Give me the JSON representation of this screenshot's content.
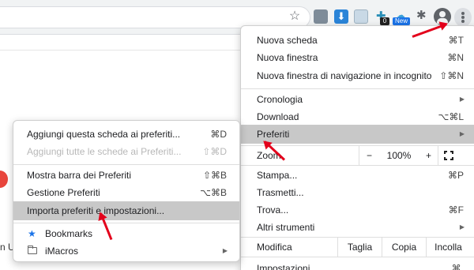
{
  "toolbar": {
    "star_icon": "star-icon",
    "extensions": [
      "ext-icon",
      "download-ext-icon",
      "image-ext-icon",
      "puzzle-ext-icon",
      "cloud-ext-icon",
      "extensions-puzzle-icon"
    ],
    "badge_count": "0",
    "badge_new": "New"
  },
  "page": {
    "partial_text": "n U"
  },
  "main_menu": {
    "items": [
      {
        "label": "Nuova scheda",
        "shortcut": "⌘T"
      },
      {
        "label": "Nuova finestra",
        "shortcut": "⌘N"
      },
      {
        "label": "Nuova finestra di navigazione in incognito",
        "shortcut": "⇧⌘N"
      },
      {
        "label": "Cronologia",
        "submenu": true
      },
      {
        "label": "Download",
        "shortcut": "⌥⌘L"
      },
      {
        "label": "Preferiti",
        "submenu": true,
        "highlighted": true
      },
      {
        "label": "Stampa...",
        "shortcut": "⌘P"
      },
      {
        "label": "Trasmetti..."
      },
      {
        "label": "Trova...",
        "shortcut": "⌘F"
      },
      {
        "label": "Altri strumenti",
        "submenu": true
      },
      {
        "label": "Impostazioni",
        "shortcut": "⌘,"
      }
    ],
    "zoom": {
      "label": "Zoom",
      "minus": "−",
      "value": "100%",
      "plus": "+"
    },
    "edit": {
      "label": "Modifica",
      "cut": "Taglia",
      "copy": "Copia",
      "paste": "Incolla"
    }
  },
  "sub_menu": {
    "items": [
      {
        "label": "Aggiungi questa scheda ai preferiti...",
        "shortcut": "⌘D"
      },
      {
        "label": "Aggiungi tutte le schede ai Preferiti...",
        "shortcut": "⇧⌘D",
        "disabled": true
      },
      {
        "label": "Mostra barra dei Preferiti",
        "shortcut": "⇧⌘B"
      },
      {
        "label": "Gestione Preferiti",
        "shortcut": "⌥⌘B"
      },
      {
        "label": "Importa preferiti e impostazioni...",
        "highlighted": true
      },
      {
        "label": "Bookmarks",
        "icon": "star-icon"
      },
      {
        "label": "iMacros",
        "icon": "folder-icon",
        "submenu": true
      }
    ]
  },
  "colors": {
    "highlight": "#c8c8c8",
    "arrow": "#e3001b",
    "accent": "#1a73e8"
  }
}
